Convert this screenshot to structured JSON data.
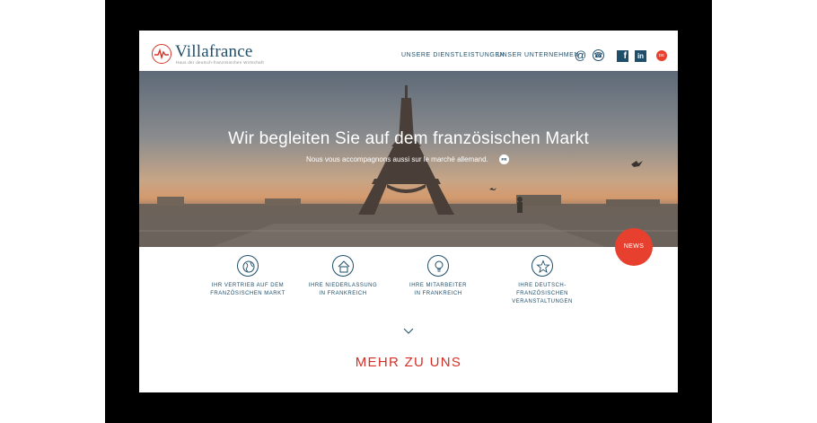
{
  "brand": {
    "name": "Villafrance",
    "tagline": "Haus der deutsch-französischen Wirtschaft"
  },
  "nav": {
    "services": "UNSERE DIENSTLEISTUNGEN",
    "company": "UNSER UNTERNEHMEN",
    "icons": [
      "at-icon",
      "phone-icon",
      "facebook-icon",
      "linkedin-icon"
    ],
    "language": "DE"
  },
  "hero": {
    "title": "Wir begleiten Sie auf dem französischen Markt",
    "subtitle": "Nous vous accompagnons aussi sur le marché allemand.",
    "badge": "FR",
    "news": "NEWS"
  },
  "services": [
    {
      "icon": "globe-icon",
      "line1": "IHR VERTRIEB AUF DEM",
      "line2": "FRANZÖSISCHEN MARKT"
    },
    {
      "icon": "house-icon",
      "line1": "IHRE NIEDERLASSUNG",
      "line2": "IN FRANKREICH"
    },
    {
      "icon": "lightbulb-icon",
      "line1": "IHRE MITARBEITER",
      "line2": "IN FRANKREICH"
    },
    {
      "icon": "star-icon",
      "line1": "IHRE DEUTSCH-FRANZÖSISCHEN",
      "line2": "VERANSTALTUNGEN"
    }
  ],
  "more": "MEHR ZU UNS",
  "colors": {
    "accent": "#e8402e",
    "brand": "#1e4e6a"
  }
}
